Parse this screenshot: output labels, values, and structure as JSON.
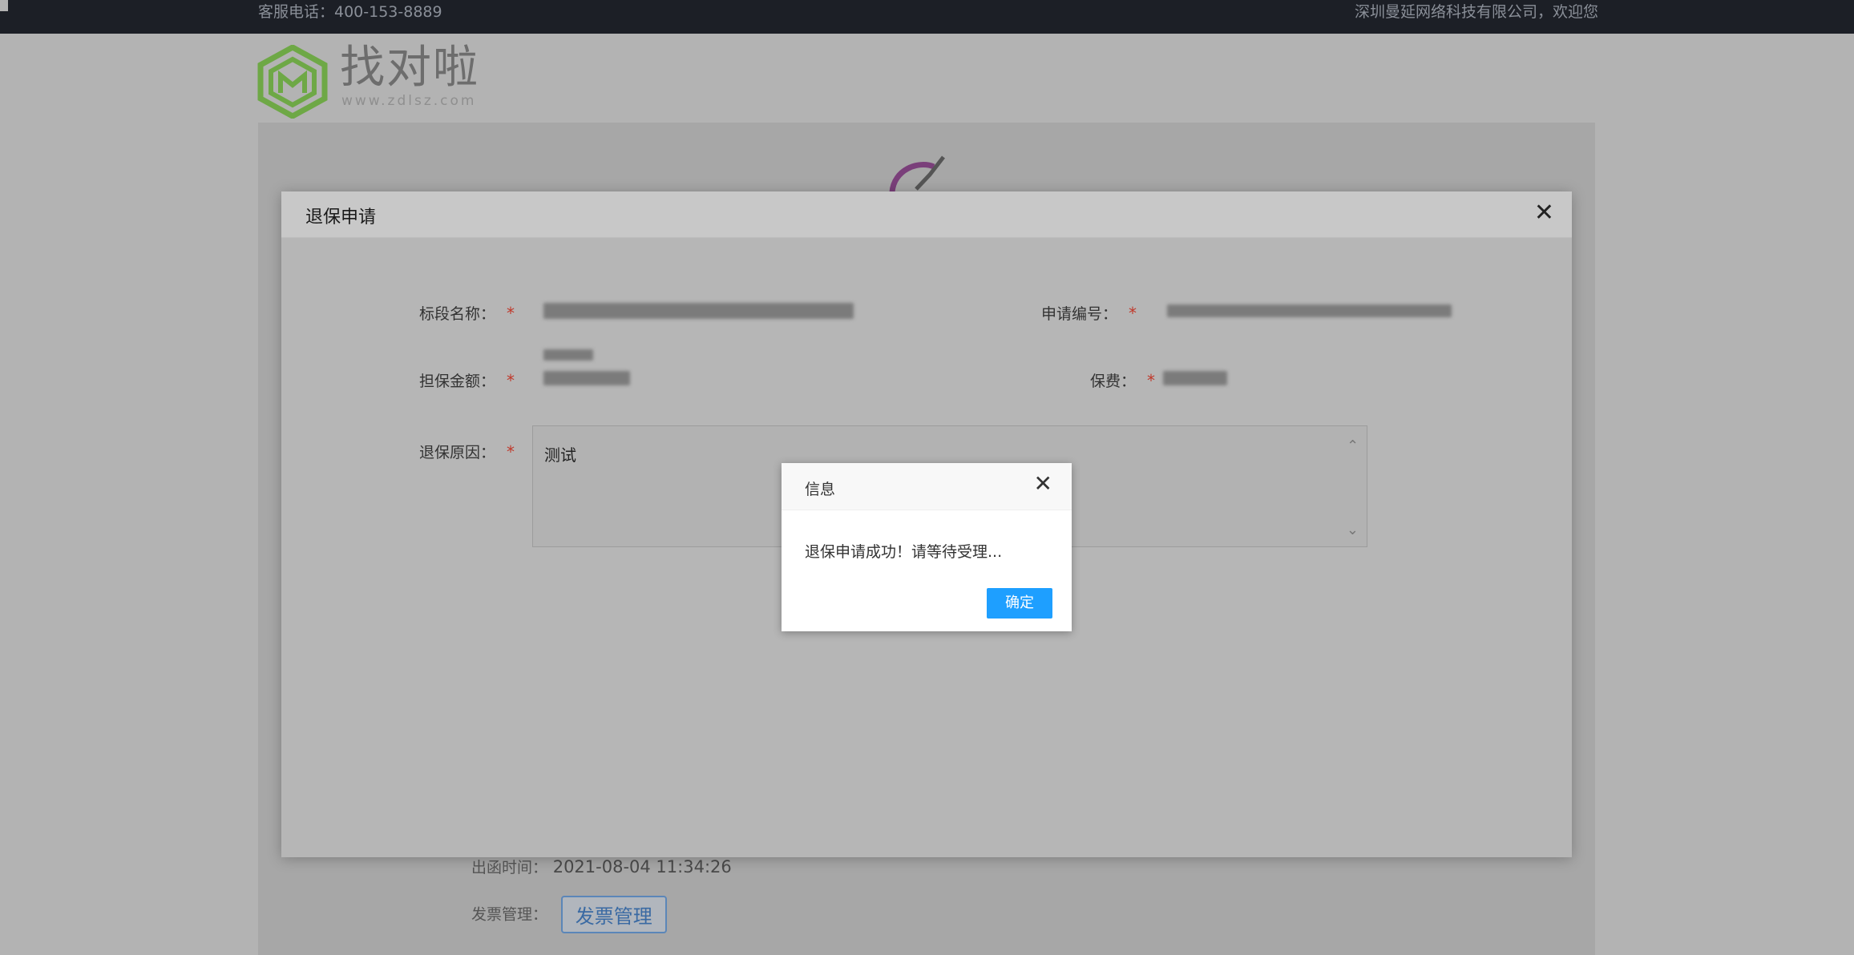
{
  "topbar": {
    "hotline": "客服电话：400-153-8889",
    "welcome": "深圳曼延网络科技有限公司，欢迎您"
  },
  "logo": {
    "name": "找对啦",
    "url": "www.zdlsz.com"
  },
  "background": {
    "issue_time_label": "出函时间：",
    "issue_time_value": "2021-08-04 11:34:26",
    "invoice_label": "发票管理：",
    "invoice_button": "发票管理"
  },
  "modal": {
    "title": "退保申请",
    "fields": {
      "section_name_label": "标段名称：",
      "application_no_label": "申请编号：",
      "guarantee_amount_label": "担保金额：",
      "fee_label": "保费：",
      "reason_label": "退保原因：",
      "reason_value": "测试"
    },
    "required_mark": "*"
  },
  "dialog": {
    "title": "信息",
    "message": "退保申请成功！请等待受理...",
    "ok_label": "确定"
  },
  "colors": {
    "topbar_bg": "#1c1f26",
    "required": "#c0392b",
    "primary_button": "#1e9fff",
    "logo_green": "#6ea846"
  }
}
